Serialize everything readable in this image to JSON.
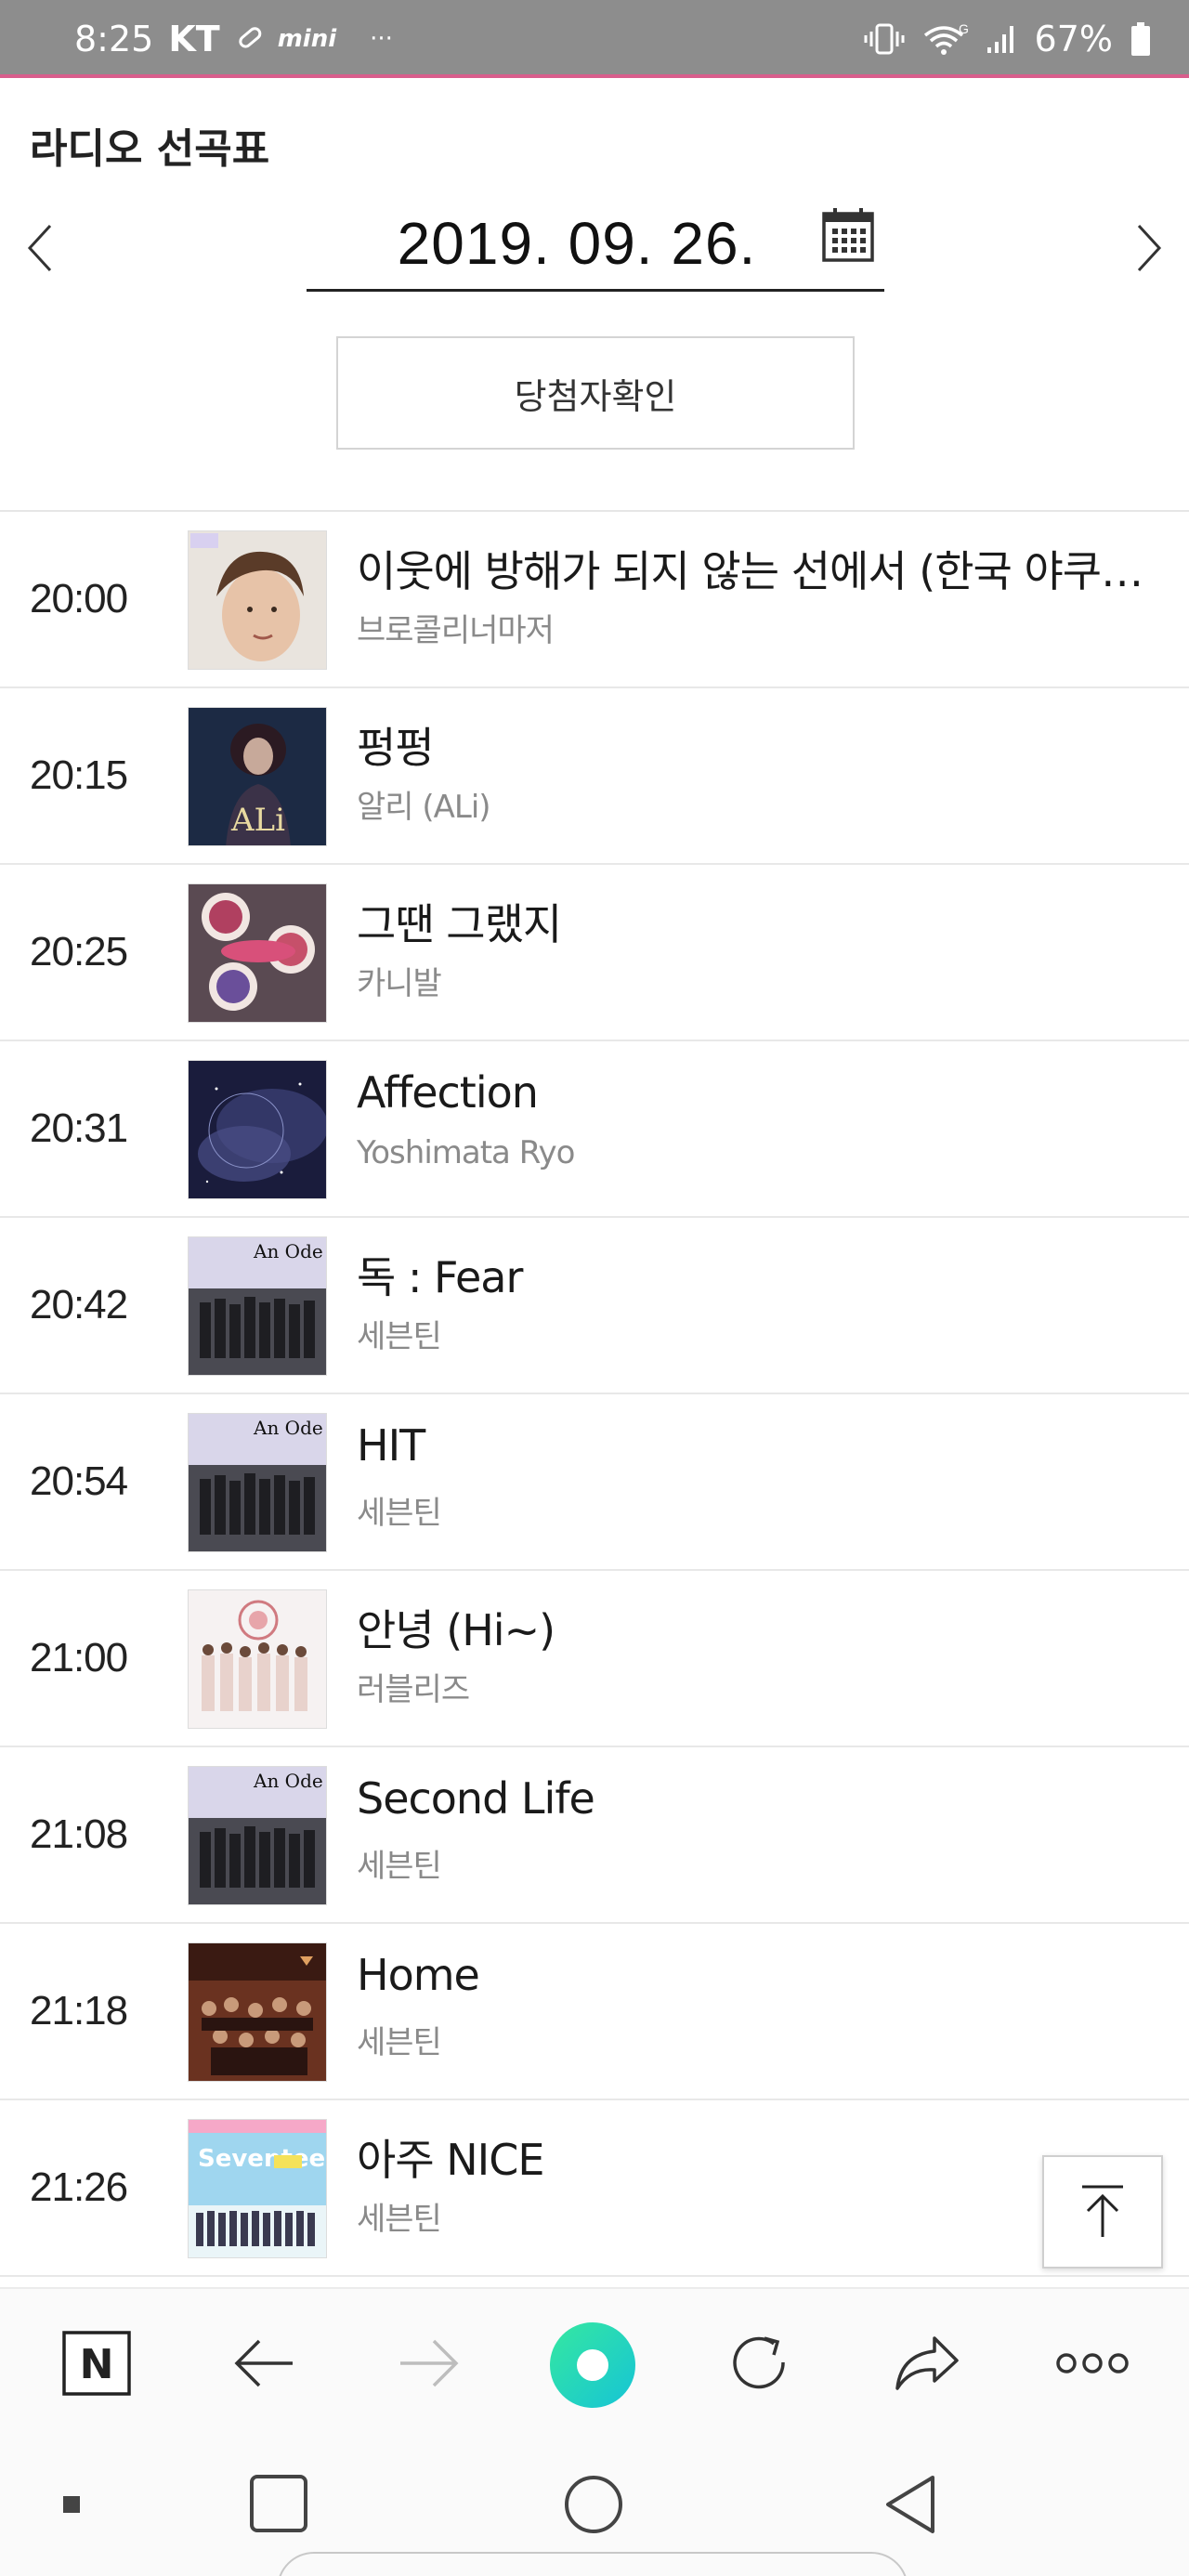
{
  "status_bar": {
    "time": "8:25",
    "carrier": "KT",
    "mini_label": "mini",
    "dots": "···",
    "battery": "67%",
    "network": "G"
  },
  "header": {
    "title": "라디오 선곡표",
    "date": "2019. 09. 26.",
    "winner_button": "당첨자확인"
  },
  "playlist": [
    {
      "time": "20:00",
      "song": "이웃에 방해가 되지 않는 선에서 (한국 야쿠르트 …",
      "artist": "브로콜리너마저"
    },
    {
      "time": "20:15",
      "song": "펑펑",
      "artist": "알리 (ALi)"
    },
    {
      "time": "20:25",
      "song": "그땐 그랬지",
      "artist": "카니발"
    },
    {
      "time": "20:31",
      "song": "Affection",
      "artist": "Yoshimata Ryo"
    },
    {
      "time": "20:42",
      "song": "독 : Fear",
      "artist": "세븐틴"
    },
    {
      "time": "20:54",
      "song": "HIT",
      "artist": "세븐틴"
    },
    {
      "time": "21:00",
      "song": "안녕 (Hi~)",
      "artist": "러블리즈"
    },
    {
      "time": "21:08",
      "song": "Second Life",
      "artist": "세븐틴"
    },
    {
      "time": "21:18",
      "song": "Home",
      "artist": "세븐틴"
    },
    {
      "time": "21:26",
      "song": "아주 NICE",
      "artist": "세븐틴"
    }
  ],
  "album_art": {
    "ali": "ALi",
    "an_ode": "An Ode",
    "seventeen": "Seventeen"
  },
  "browser_toolbar": {
    "naver_label": "N",
    "accent_color": "#1fd3a4"
  },
  "colors": {
    "status_bar_bg": "#8d8d8d",
    "status_accent": "#d85e8c",
    "divider": "#e8e8e8"
  }
}
